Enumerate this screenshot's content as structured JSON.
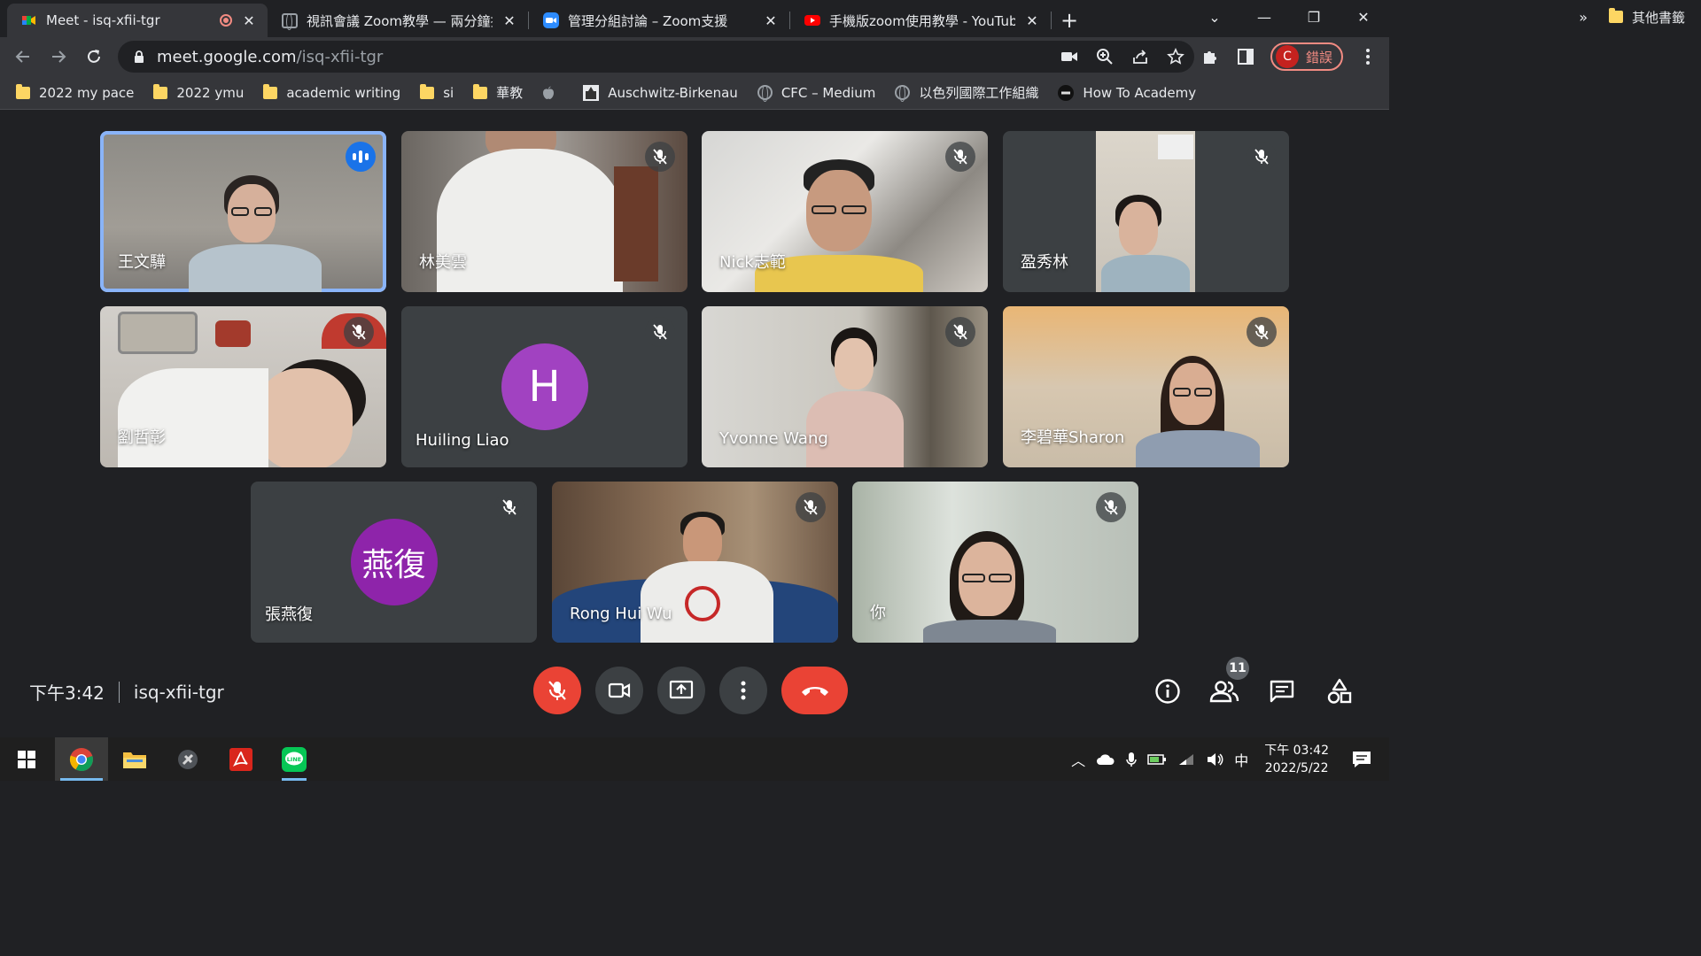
{
  "browser": {
    "tabs": [
      {
        "title": "Meet - isq-xfii-tgr",
        "active": true
      },
      {
        "title": "視訊會議 Zoom教學 — 兩分鐘搞",
        "active": false
      },
      {
        "title": "管理分組討論 – Zoom支援",
        "active": false
      },
      {
        "title": "手機版zoom使用教學 - YouTube",
        "active": false
      }
    ],
    "url_host": "meet.google.com",
    "url_path": "/isq-xfii-tgr",
    "profile_initial": "C",
    "profile_status": "錯誤"
  },
  "bookmarks": [
    {
      "label": "2022 my pace",
      "icon": "folder"
    },
    {
      "label": "2022 ymu",
      "icon": "folder"
    },
    {
      "label": "academic writing",
      "icon": "folder"
    },
    {
      "label": "si",
      "icon": "folder"
    },
    {
      "label": "華教",
      "icon": "folder"
    },
    {
      "label": "",
      "icon": "apple"
    },
    {
      "label": "Auschwitz-Birkenau",
      "icon": "auschwitz"
    },
    {
      "label": "CFC – Medium",
      "icon": "globe"
    },
    {
      "label": "以色列國際工作組織",
      "icon": "globe"
    },
    {
      "label": "How To Academy",
      "icon": "howto"
    }
  ],
  "bookmarks_more": "»",
  "bookmarks_other": "其他書籤",
  "participants": [
    {
      "name": "王文驊",
      "speaking": true
    },
    {
      "name": "林美雲"
    },
    {
      "name": "Nick志範"
    },
    {
      "name": "盈秀林"
    },
    {
      "name": "劉哲彰"
    },
    {
      "name": "Huiling Liao",
      "avatar_letter": "H",
      "avatar_color": "#a142c1"
    },
    {
      "name": "Yvonne Wang"
    },
    {
      "name": "李碧華Sharon"
    },
    {
      "name": "張燕復",
      "avatar_letter": "燕復",
      "avatar_color": "#8e24aa"
    },
    {
      "name": "Rong Hui Wu"
    },
    {
      "name": "你"
    }
  ],
  "meeting": {
    "time": "下午3:42",
    "code": "isq-xfii-tgr",
    "participant_count": "11"
  },
  "taskbar": {
    "ime": "中",
    "time": "下午 03:42",
    "date": "2022/5/22"
  },
  "colors": {
    "accent_blue": "#8ab4f8",
    "mute_red": "#ea4335",
    "bg": "#202124"
  }
}
